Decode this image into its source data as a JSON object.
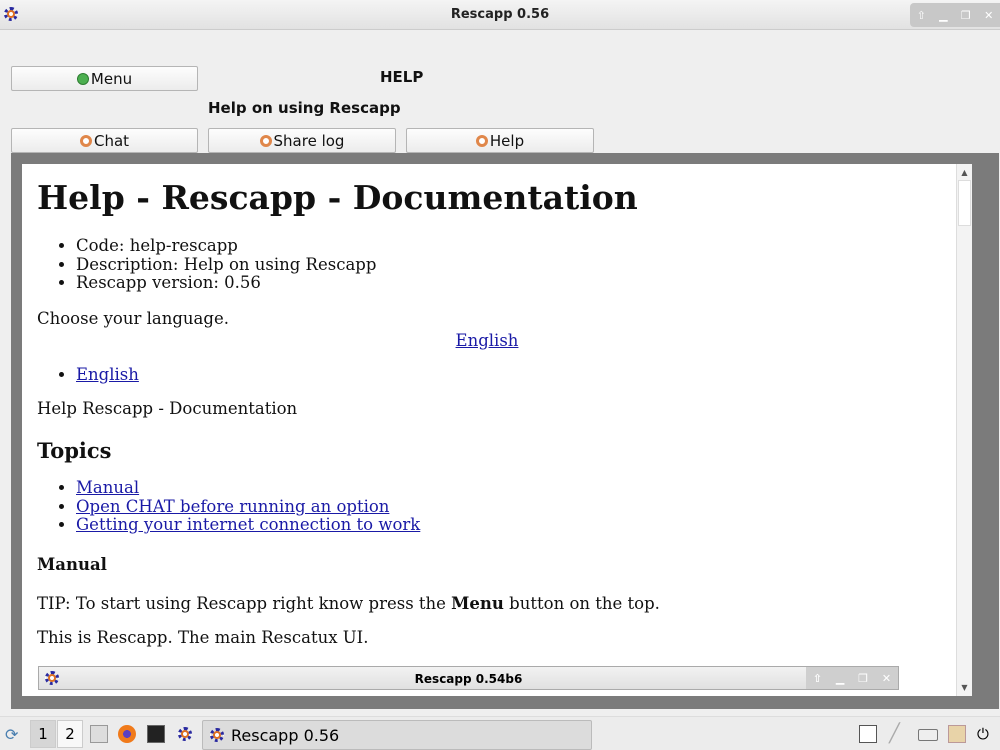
{
  "window": {
    "title": "Rescapp 0.56"
  },
  "header": {
    "menu_label": "Menu",
    "section_title": "HELP",
    "subtitle": "Help on using Rescapp"
  },
  "toolbar": {
    "chat_label": "Chat",
    "share_log_label": "Share log",
    "help_label": "Help"
  },
  "doc": {
    "title": "Help - Rescapp - Documentation",
    "meta": [
      "Code: help-rescapp",
      "Description: Help on using Rescapp",
      "Rescapp version: 0.56"
    ],
    "choose_language": "Choose your language.",
    "language_link_center": "English",
    "language_links": [
      "English"
    ],
    "intro": "Help Rescapp - Documentation",
    "topics_heading": "Topics",
    "topics": [
      "Manual",
      "Open CHAT before running an option",
      "Getting your internet connection to work"
    ],
    "manual_heading": "Manual",
    "tip_prefix": "TIP: To start using Rescapp right know press the ",
    "tip_bold": "Menu",
    "tip_suffix": " button on the top.",
    "main_ui": "This is Rescapp. The main Rescatux UI.",
    "screenshot_title": "Rescapp 0.54b6"
  },
  "taskbar": {
    "workspaces": [
      "1",
      "2"
    ],
    "task_label": "Rescapp 0.56"
  }
}
